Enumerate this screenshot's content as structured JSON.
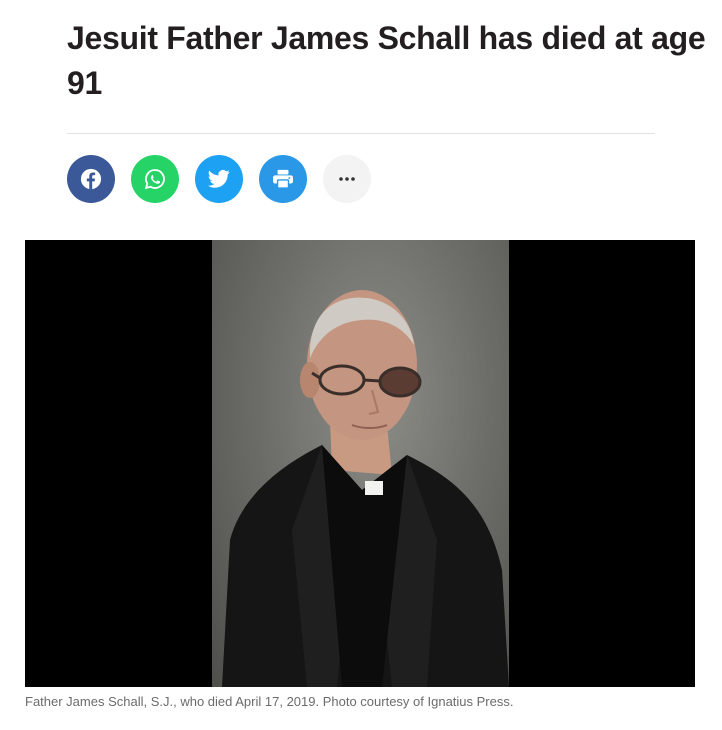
{
  "article": {
    "headline": "Jesuit Father James Schall has died at age 91"
  },
  "share": {
    "buttons": [
      {
        "network": "facebook",
        "icon": "facebook-icon",
        "color": "#3b5998"
      },
      {
        "network": "whatsapp",
        "icon": "whatsapp-icon",
        "color": "#25d366"
      },
      {
        "network": "twitter",
        "icon": "twitter-icon",
        "color": "#1da1f2"
      },
      {
        "network": "print",
        "icon": "print-icon",
        "color": "#2a98e6"
      },
      {
        "network": "more",
        "icon": "more-icon",
        "color": "#f3f3f3"
      }
    ]
  },
  "photo": {
    "caption": "Father James Schall, S.J., who died April 17, 2019. Photo courtesy of Ignatius Press."
  }
}
